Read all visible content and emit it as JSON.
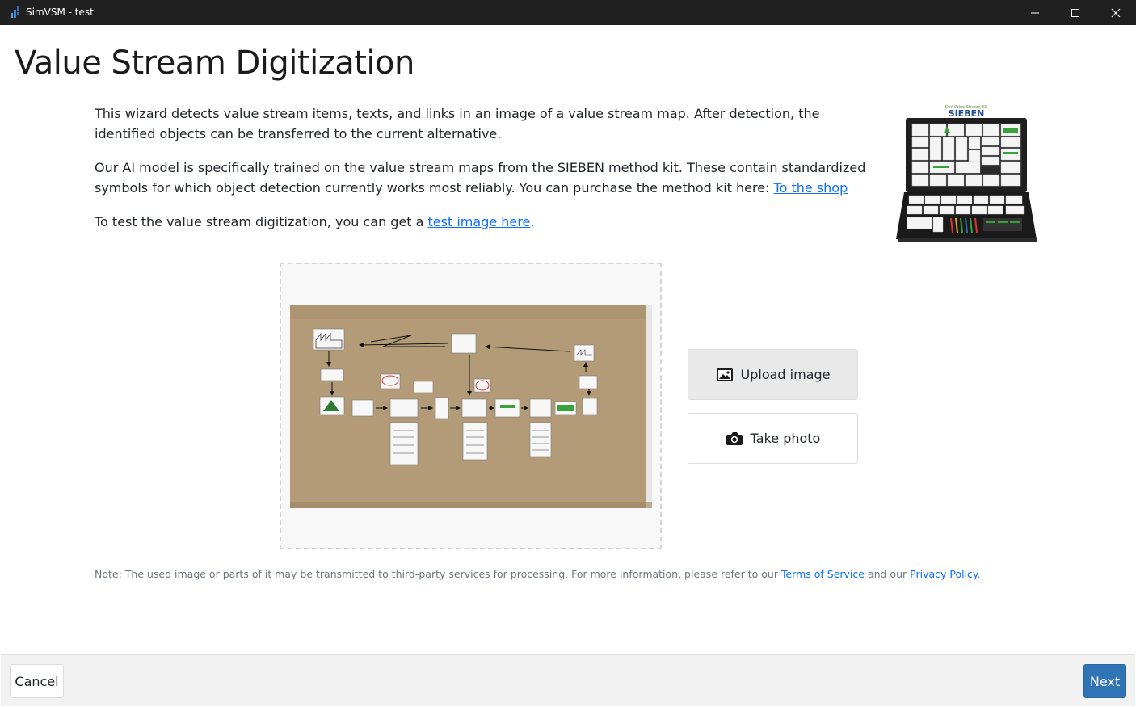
{
  "window": {
    "title": "SimVSM - test"
  },
  "page": {
    "title": "Value Stream Digitization"
  },
  "intro": {
    "paragraph1": "This wizard detects value stream items, texts, and links in an image of a value stream map. After detection, the identified objects can be transferred to the current alternative.",
    "paragraph2_text": "Our AI model is specifically trained on the value stream maps from the SIEBEN method kit. These contain standardized symbols for which object detection currently works most reliably. You can purchase the method kit here: ",
    "paragraph2_link": "To the shop",
    "paragraph3_text": "To test the value stream digitization, you can get a ",
    "paragraph3_link": "test image here",
    "paragraph3_end": "."
  },
  "kit": {
    "brand": "SIEBEN",
    "tagline": "Der Value Stream Kit"
  },
  "actions": {
    "upload_label": "Upload image",
    "photo_label": "Take photo"
  },
  "note": {
    "text1": "Note: The used image or parts of it may be transmitted to third-party services for processing. For more information, please refer to our ",
    "tos_link": "Terms of Service",
    "text2": " and our ",
    "privacy_link": "Privacy Policy",
    "text3": "."
  },
  "footer": {
    "cancel_label": "Cancel",
    "next_label": "Next"
  },
  "colors": {
    "accent": "#2f74b5",
    "link": "#0d6efd",
    "titlebar": "#202020",
    "kraft_paper": "#b39b78"
  },
  "icons": {
    "upload": "image-icon",
    "photo": "camera-icon"
  }
}
